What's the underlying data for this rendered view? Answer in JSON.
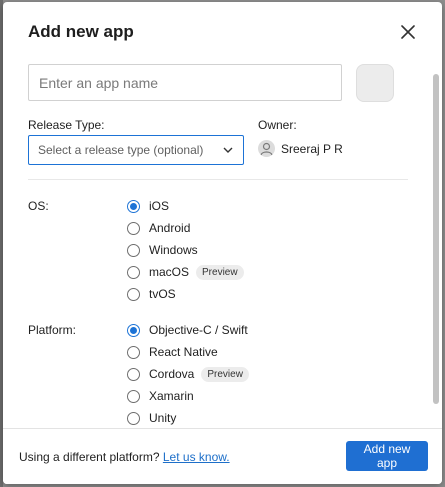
{
  "dialog": {
    "title": "Add new app"
  },
  "form": {
    "name_placeholder": "Enter an app name",
    "release_type": {
      "label": "Release Type:",
      "selected": "Select a release type (optional)"
    },
    "owner": {
      "label": "Owner:",
      "name": "Sreeraj P R"
    }
  },
  "os": {
    "label": "OS:",
    "options": [
      {
        "label": "iOS",
        "checked": true
      },
      {
        "label": "Android",
        "checked": false
      },
      {
        "label": "Windows",
        "checked": false
      },
      {
        "label": "macOS",
        "checked": false,
        "badge": "Preview"
      },
      {
        "label": "tvOS",
        "checked": false
      }
    ]
  },
  "platform": {
    "label": "Platform:",
    "options": [
      {
        "label": "Objective-C / Swift",
        "checked": true
      },
      {
        "label": "React Native",
        "checked": false
      },
      {
        "label": "Cordova",
        "checked": false,
        "badge": "Preview"
      },
      {
        "label": "Xamarin",
        "checked": false
      },
      {
        "label": "Unity",
        "checked": false
      }
    ]
  },
  "footer": {
    "text": "Using a different platform?",
    "link": "Let us know.",
    "submit_label": "Add new app"
  },
  "colors": {
    "accent": "#1f6fd2",
    "link": "#1d6fc9"
  }
}
